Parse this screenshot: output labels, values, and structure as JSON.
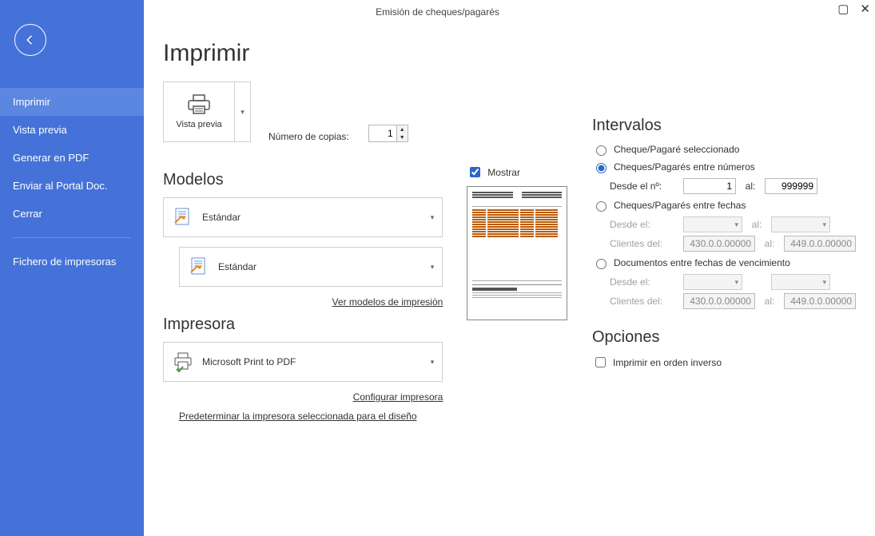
{
  "window": {
    "title": "Emisión de cheques/pagarés"
  },
  "sidebar": {
    "items": [
      {
        "label": "Imprimir",
        "selected": true
      },
      {
        "label": "Vista previa"
      },
      {
        "label": "Generar en PDF"
      },
      {
        "label": "Enviar al Portal Doc."
      },
      {
        "label": "Cerrar"
      }
    ],
    "bottom": [
      {
        "label": "Fichero de impresoras"
      }
    ]
  },
  "page": {
    "title": "Imprimir"
  },
  "top": {
    "preview_label": "Vista previa",
    "copies_label": "Número de copias:",
    "copies_value": "1"
  },
  "modelos": {
    "heading": "Modelos",
    "primary": "Estándar",
    "secondary": "Estándar",
    "link": "Ver modelos de impresión"
  },
  "impresora": {
    "heading": "Impresora",
    "printer": "Microsoft Print to PDF",
    "link_config": "Configurar impresora",
    "link_predet": "Predeterminar la impresora seleccionada para el diseño"
  },
  "preview": {
    "mostrar_label": "Mostrar",
    "mostrar_checked": true
  },
  "intervalos": {
    "heading": "Intervalos",
    "opts": {
      "seleccionado": "Cheque/Pagaré seleccionado",
      "entre_num": "Cheques/Pagarés entre números",
      "entre_fechas": "Cheques/Pagarés entre fechas",
      "entre_venc": "Documentos entre fechas de vencimiento"
    },
    "labels": {
      "desde_no": "Desde el nº:",
      "al": "al:",
      "desde_el": "Desde el:",
      "clientes_del": "Clientes del:"
    },
    "values": {
      "num_from": "1",
      "num_to": "999999",
      "cli_from": "430.0.0.00000",
      "cli_to": "449.0.0.00000",
      "cli2_from": "430.0.0.00000",
      "cli2_to": "449.0.0.00000"
    }
  },
  "opciones": {
    "heading": "Opciones",
    "inverso": "Imprimir en orden inverso"
  }
}
